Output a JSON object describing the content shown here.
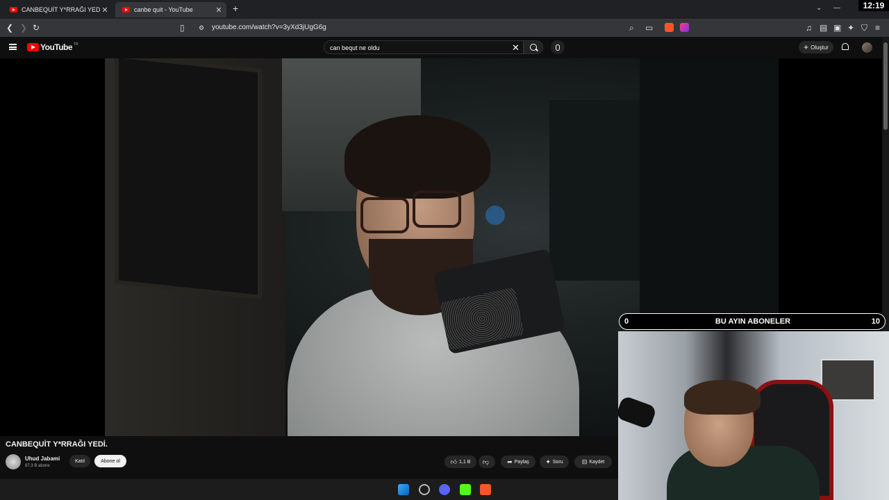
{
  "browser": {
    "tabs": [
      {
        "title": "CANBEQUİT Y*RRAĞI YEDİ. - YouTube",
        "active": false
      },
      {
        "title": "canbe quit - YouTube",
        "active": true
      }
    ],
    "new_tab": "+",
    "url": "youtube.com/watch?v=3yXd3jUgG6g",
    "clock": "12:19"
  },
  "youtube": {
    "logo_text": "YouTube",
    "logo_country": "TR",
    "search_value": "can bequt ne oldu",
    "create_label": "Oluştur"
  },
  "video": {
    "title": "CANBEQUİT Y*RRAĞI YEDİ.",
    "channel_name": "Uhud Jabami",
    "channel_subs": "97,3 B abone",
    "join_label": "Katıl",
    "subscribe_label": "Abone ol",
    "like_count": "1,1 B",
    "share_label": "Paylaş",
    "ask_label": "Soru",
    "save_label": "Kaydet"
  },
  "stream_overlay": {
    "left_value": "0",
    "title": "BU AYIN ABONELER",
    "right_value": "10"
  },
  "colors": {
    "youtube_red": "#ff0000",
    "background": "#0f0f0f",
    "chip": "#272727"
  }
}
